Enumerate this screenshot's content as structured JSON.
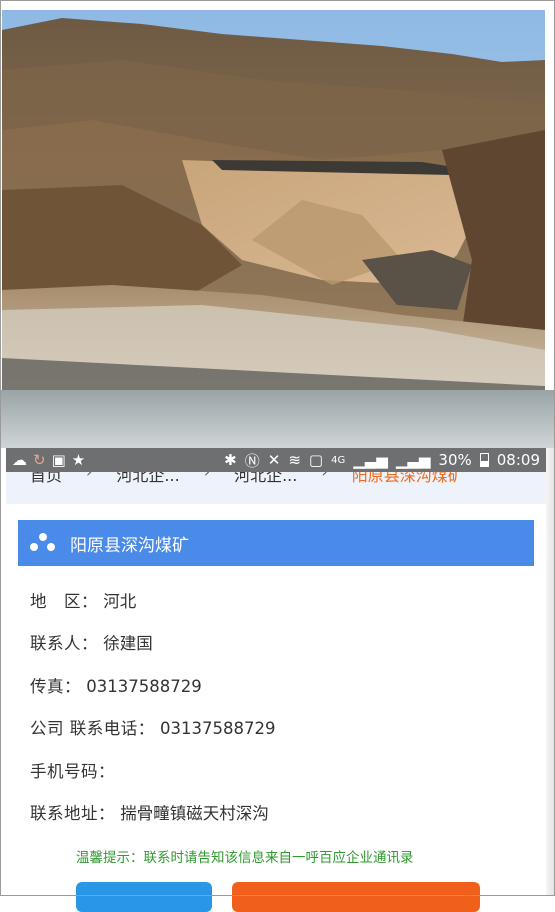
{
  "statusbar": {
    "battery_percent": "30%",
    "time": "08:09",
    "network": "4G"
  },
  "breadcrumb": {
    "home": "首页",
    "level1": "河北企...",
    "level2": "河北企...",
    "current": "阳原县深沟煤矿",
    "separator": "›"
  },
  "company": {
    "title": "阳原县深沟煤矿",
    "region_label": "地　区：",
    "region": "河北",
    "contact_label": "联系人：",
    "contact": "徐建国",
    "fax_label": "传真：",
    "fax": "03137588729",
    "phone_label": "公司 联系电话：",
    "phone": "03137588729",
    "mobile_label": "手机号码：",
    "mobile": "",
    "address_label": "联系地址：",
    "address": "揣骨疃镇磁天村深沟"
  },
  "tip": "温馨提示：联系时请告知该信息来自一呼百应企业通讯录",
  "colors": {
    "header_blue": "#4a8ae8",
    "tip_green": "#2f9a2f",
    "breadcrumb_current": "#f16a1b",
    "button_blue": "#2a97e6",
    "button_orange": "#f0601b"
  }
}
